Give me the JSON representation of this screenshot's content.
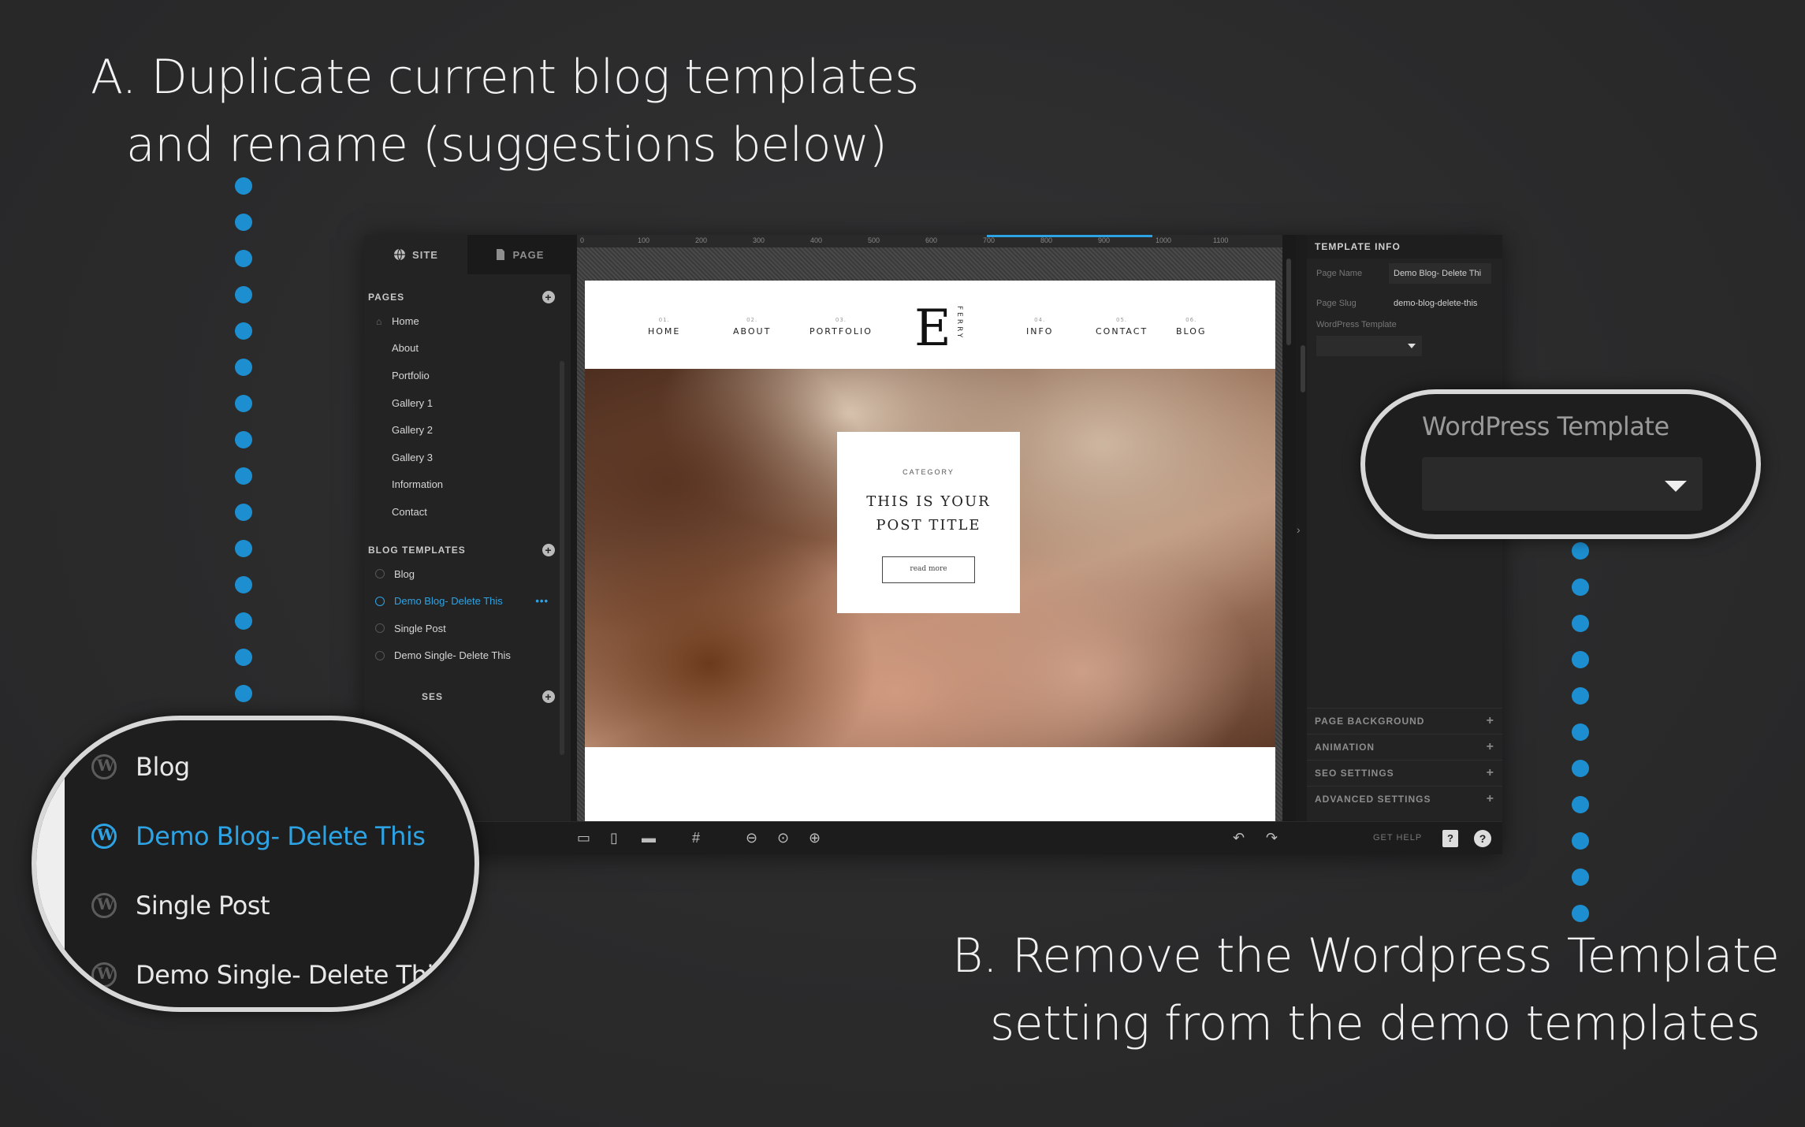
{
  "annotations": {
    "a_line1": "A. Duplicate current blog templates",
    "a_line2": "and rename (suggestions below)",
    "b_line1": "B. Remove the Wordpress Template",
    "b_line2": "setting from the demo templates"
  },
  "left_panel": {
    "tabs": [
      {
        "label": "SITE",
        "icon": "globe-icon"
      },
      {
        "label": "PAGE",
        "icon": "page-icon"
      }
    ],
    "pages_heading": "PAGES",
    "pages": [
      "Home",
      "About",
      "Portfolio",
      "Gallery 1",
      "Gallery 2",
      "Gallery 3",
      "Information",
      "Contact"
    ],
    "blog_templates_heading": "BLOG TEMPLATES",
    "blog_templates": [
      {
        "label": "Blog",
        "active": false
      },
      {
        "label": "Demo Blog- Delete This",
        "active": true
      },
      {
        "label": "Single Post",
        "active": false
      },
      {
        "label": "Demo Single- Delete This",
        "active": false
      }
    ],
    "more_indicator": "•••",
    "partial_heading": "SES"
  },
  "ruler": {
    "ticks": [
      "0",
      "100",
      "200",
      "300",
      "400",
      "500",
      "600",
      "700",
      "800",
      "900",
      "1000",
      "1100"
    ]
  },
  "site": {
    "nav_left": [
      {
        "num": "01.",
        "label": "HOME"
      },
      {
        "num": "02.",
        "label": "ABOUT"
      },
      {
        "num": "03.",
        "label": "PORTFOLIO"
      }
    ],
    "nav_right": [
      {
        "num": "04.",
        "label": "INFO"
      },
      {
        "num": "05.",
        "label": "CONTACT"
      },
      {
        "num": "06.",
        "label": "BLOG"
      }
    ],
    "logo_letter": "E",
    "logo_word": "FERRY",
    "post": {
      "category": "CATEGORY",
      "title_line1": "THIS IS YOUR",
      "title_line2": "POST TITLE",
      "button": "read more"
    }
  },
  "right_panel": {
    "heading": "TEMPLATE INFO",
    "page_name_label": "Page Name",
    "page_name_value": "Demo Blog- Delete Thi",
    "page_slug_label": "Page Slug",
    "page_slug_value": "demo-blog-delete-this",
    "wp_template_label": "WordPress Template",
    "accordions": [
      "PAGE BACKGROUND",
      "ANIMATION",
      "SEO SETTINGS",
      "ADVANCED SETTINGS"
    ]
  },
  "bottom_bar": {
    "get_help": "GET HELP",
    "help_box": "?",
    "help_bubble": "?"
  },
  "magnifier_a": {
    "items": [
      {
        "label": "Blog",
        "active": false
      },
      {
        "label": "Demo Blog- Delete This",
        "active": true
      },
      {
        "label": "Single Post",
        "active": false
      },
      {
        "label": "Demo Single- Delete This",
        "active": false
      }
    ]
  },
  "magnifier_b": {
    "label": "WordPress Template"
  },
  "colors": {
    "accent": "#2ea3e3",
    "dots": "#1d8fd1",
    "background": "#2b2b2c"
  }
}
